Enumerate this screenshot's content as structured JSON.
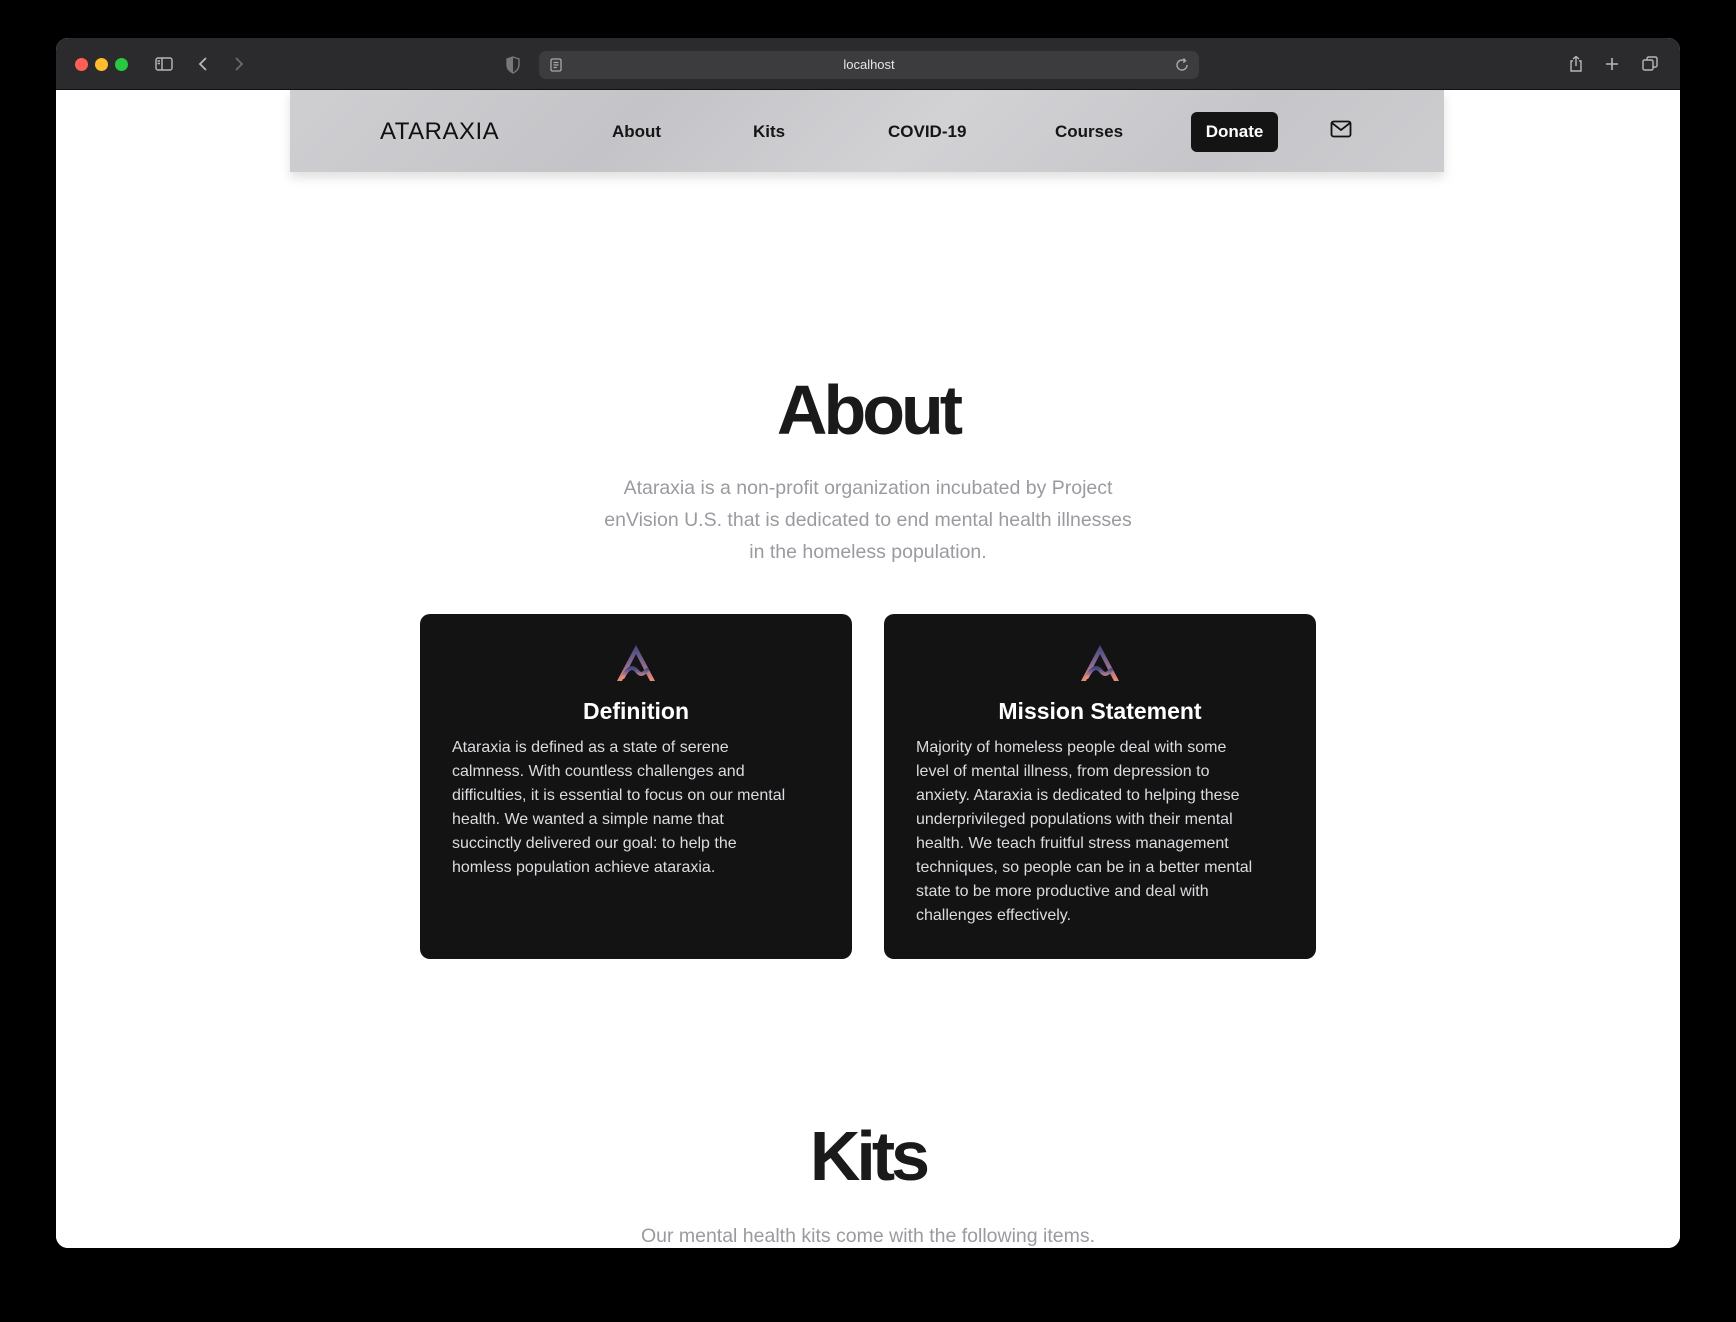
{
  "browser": {
    "url": "localhost"
  },
  "nav": {
    "brand": "ATARAXIA",
    "links": [
      "About",
      "Kits",
      "COVID-19",
      "Courses"
    ],
    "donate_label": "Donate"
  },
  "about": {
    "title": "About",
    "lead_lines": [
      "Ataraxia is a non-profit organization incubated by Project",
      "enVision U.S. that is dedicated to end mental health illnesses",
      "in the homeless population."
    ],
    "cards": [
      {
        "title": "Definition",
        "lines": [
          "Ataraxia is defined as a state of serene",
          "calmness. With countless challenges and",
          "difficulties, it is essential to focus on our mental",
          "health. We wanted a simple name that",
          "succinctly delivered our goal: to help the",
          "homless population achieve ataraxia."
        ]
      },
      {
        "title": "Mission Statement",
        "lines": [
          "Majority of homeless people deal with some",
          "level of mental illness, from depression to",
          "anxiety. Ataraxia is dedicated to helping these",
          "underprivileged populations with their mental",
          "health. We teach fruitful stress management",
          "techniques, so people can be in a better mental",
          "state to be more productive and deal with",
          "challenges effectively."
        ]
      }
    ]
  },
  "kits": {
    "title": "Kits",
    "lead": "Our mental health kits come with the following items."
  },
  "colors": {
    "card_bg": "#131314",
    "donate_bg": "#141414",
    "lead_text": "#9a9aa0",
    "logo_gradient_top": "#4a4f86",
    "logo_gradient_bottom": "#e48a7a"
  },
  "icons": [
    "sidebar-icon",
    "back-icon",
    "forward-icon",
    "shield-icon",
    "page-icon",
    "reload-icon",
    "share-icon",
    "new-tab-icon",
    "tabs-overview-icon",
    "mail-icon",
    "ataraxia-logo-icon"
  ]
}
